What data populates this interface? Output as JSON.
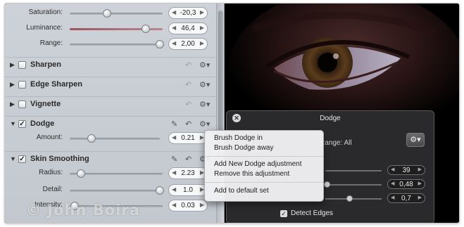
{
  "adjustments": {
    "sliders_top": [
      {
        "label": "Saturation:",
        "value": "-20,3",
        "level": 0.4,
        "track": "plain"
      },
      {
        "label": "Luminance:",
        "value": "46,4",
        "level": 0.82,
        "track": "red"
      },
      {
        "label": "Range:",
        "value": "2,00",
        "level": 0.97,
        "track": "plain"
      }
    ],
    "sections": [
      {
        "name": "Sharpen",
        "checked": false
      },
      {
        "name": "Edge Sharpen",
        "checked": false
      },
      {
        "name": "Vignette",
        "checked": false
      }
    ],
    "dodge": {
      "name": "Dodge",
      "checked": true,
      "amount_label": "Amount:",
      "amount_value": "0.21",
      "amount_level": 0.24
    },
    "skin_smoothing": {
      "name": "Skin Smoothing",
      "checked": true,
      "sliders": [
        {
          "label": "Radius:",
          "value": "2.23",
          "level": 0.12
        },
        {
          "label": "Detail:",
          "value": "1.0",
          "level": 0.97
        },
        {
          "label": "Intensity:",
          "value": "0.03",
          "level": 0.05
        }
      ]
    }
  },
  "icons": {
    "expand": "disclosure-triangle-icon",
    "reset": "reset-arrow-icon",
    "gear": "gear-icon",
    "brush": "brush-icon",
    "check": "checkmark-icon"
  },
  "watermark": "© John Boira",
  "hud": {
    "title": "Dodge",
    "range_label": "Range: All",
    "values": [
      "39",
      "0,48",
      "0,7"
    ],
    "levels": [
      0.55,
      0.3,
      0.6
    ],
    "detect_edges_label": "Detect Edges",
    "detect_edges_checked": true
  },
  "context_menu": {
    "group1": [
      "Brush Dodge in",
      "Brush Dodge away"
    ],
    "group2": [
      "Add New Dodge adjustment",
      "Remove this adjustment"
    ],
    "group3": [
      "Add to default set"
    ]
  },
  "colors": {
    "panel": "#c8cdd3",
    "hud": "#2c2c2e",
    "menu": "#eff0f2",
    "viewport": "#000000"
  }
}
